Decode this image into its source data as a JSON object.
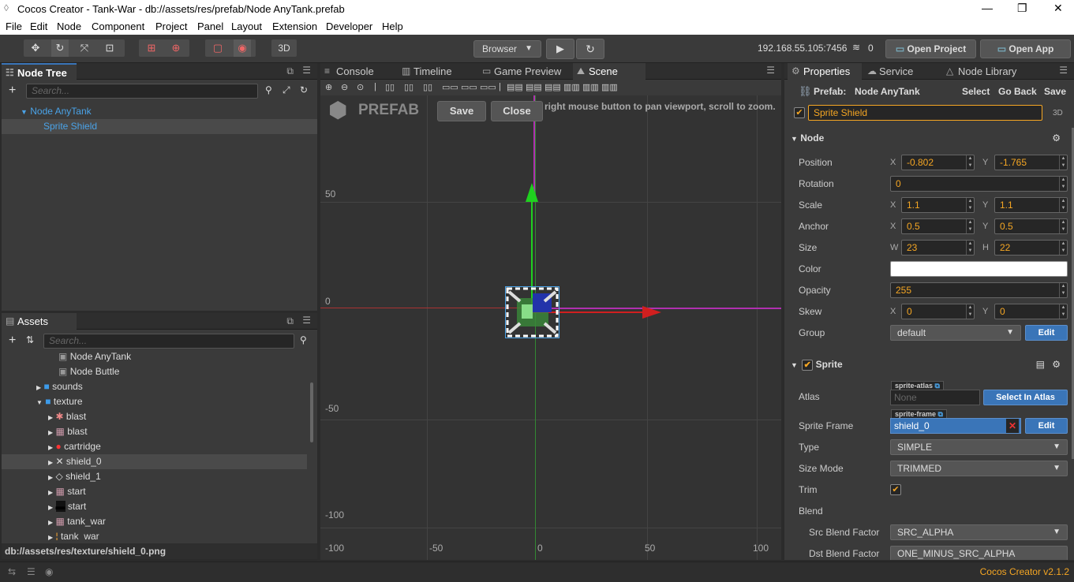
{
  "titlebar": {
    "title": "Cocos Creator - Tank-War - db://assets/res/prefab/Node AnyTank.prefab"
  },
  "menu": [
    "File",
    "Edit",
    "Node",
    "Component",
    "Project",
    "Panel",
    "Layout",
    "Extension",
    "Developer",
    "Help"
  ],
  "toolbar": {
    "mode3d": "3D",
    "platform": "Browser",
    "ip": "192.168.55.105:7456",
    "conn_count": "0",
    "open_project": "Open Project",
    "open_app": "Open App"
  },
  "node_tree": {
    "tab": "Node Tree",
    "search_placeholder": "Search...",
    "nodes": [
      "Node AnyTank",
      "Sprite Shield"
    ]
  },
  "assets": {
    "tab": "Assets",
    "search_placeholder": "Search...",
    "items": [
      {
        "label": "Node AnyTank"
      },
      {
        "label": "Node Buttle"
      },
      {
        "label": "sounds"
      },
      {
        "label": "texture"
      },
      {
        "label": "blast"
      },
      {
        "label": "blast"
      },
      {
        "label": "cartridge"
      },
      {
        "label": "shield_0"
      },
      {
        "label": "shield_1"
      },
      {
        "label": "start"
      },
      {
        "label": "start"
      },
      {
        "label": "tank_war"
      },
      {
        "label": "tank_war"
      }
    ],
    "status_path": "db://assets/res/texture/shield_0.png"
  },
  "center_tabs": [
    "Console",
    "Timeline",
    "Game Preview",
    "Scene"
  ],
  "scene": {
    "prefab_label": "PREFAB",
    "save": "Save",
    "close": "Close",
    "hint": "right mouse button to pan viewport, scroll to zoom.",
    "y_ticks": [
      "50",
      "0",
      "-50",
      "-100"
    ],
    "x_ticks": [
      "-100",
      "-50",
      "0",
      "50",
      "100"
    ]
  },
  "right_tabs": [
    "Properties",
    "Service",
    "Node Library"
  ],
  "inspector": {
    "prefab_label": "Prefab:",
    "prefab_name": "Node AnyTank",
    "select": "Select",
    "go_back": "Go Back",
    "save": "Save",
    "node_name": "Sprite Shield",
    "tag3d": "3D",
    "node_section": "Node",
    "position_label": "Position",
    "pos_x": "-0.802",
    "pos_y": "-1.765",
    "rotation_label": "Rotation",
    "rotation": "0",
    "scale_label": "Scale",
    "scale_x": "1.1",
    "scale_y": "1.1",
    "anchor_label": "Anchor",
    "anchor_x": "0.5",
    "anchor_y": "0.5",
    "size_label": "Size",
    "size_w": "23",
    "size_h": "22",
    "color_label": "Color",
    "opacity_label": "Opacity",
    "opacity": "255",
    "skew_label": "Skew",
    "skew_x": "0",
    "skew_y": "0",
    "group_label": "Group",
    "group": "default",
    "edit": "Edit",
    "sprite_section": "Sprite",
    "atlas_label": "Atlas",
    "atlas_tag": "sprite-atlas",
    "atlas_value": "None",
    "select_in_atlas": "Select In Atlas",
    "frame_label": "Sprite Frame",
    "frame_tag": "sprite-frame",
    "frame_value": "shield_0",
    "type_label": "Type",
    "type": "SIMPLE",
    "size_mode_label": "Size Mode",
    "size_mode": "TRIMMED",
    "trim_label": "Trim",
    "blend_label": "Blend",
    "src_blend_label": "Src Blend Factor",
    "src_blend": "SRC_ALPHA",
    "dst_blend_label": "Dst Blend Factor",
    "dst_blend": "ONE_MINUS_SRC_ALPHA"
  },
  "status": {
    "version": "Cocos Creator v2.1.2"
  },
  "colors": {
    "accent": "#f5a623",
    "selection": "#3a75b8"
  }
}
